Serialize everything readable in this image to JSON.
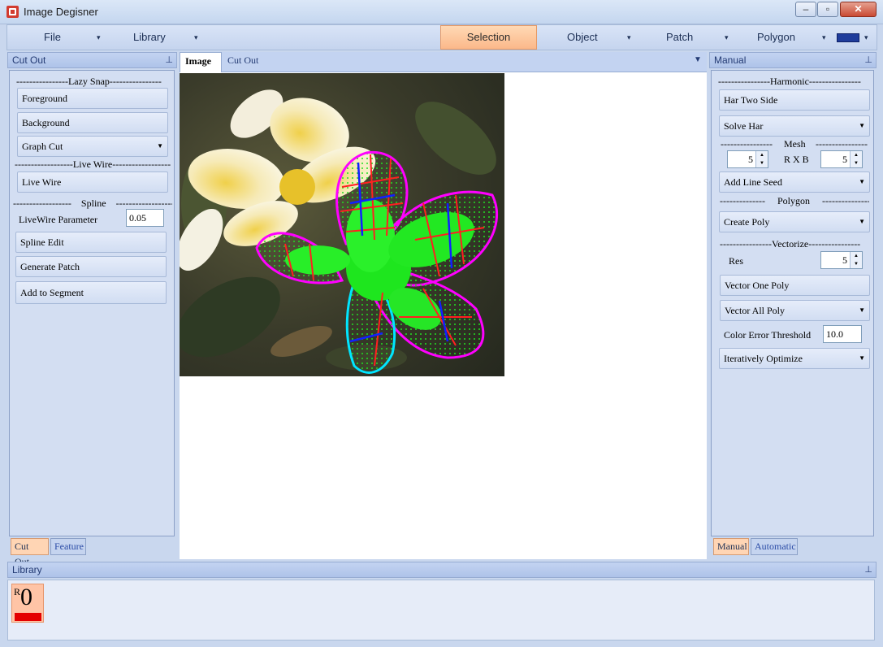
{
  "window": {
    "title": "Image Degisner",
    "minimize": "–",
    "maximize": "▫",
    "close": "✕"
  },
  "menu": {
    "file": "File",
    "library": "Library",
    "selection": "Selection",
    "object": "Object",
    "patch": "Patch",
    "polygon": "Polygon",
    "arrow": "▾",
    "polygon_color": "#1f3c9b"
  },
  "left_panel": {
    "title": "Cut Out",
    "lazy_snap_divider": "----------------Lazy Snap----------------",
    "foreground": "Foreground",
    "background": "Background",
    "graph_cut": "Graph Cut",
    "live_wire_divider": "------------------Live Wire------------------",
    "live_wire": "Live Wire",
    "spline_divider": "------------------    Spline    ------------------",
    "live_wire_param_label": "LiveWire Parameter",
    "live_wire_param_value": "0.05",
    "spline_edit": "Spline Edit",
    "generate_patch": "Generate Patch",
    "add_to_segment": "Add to Segment",
    "tabs": [
      "Cut Out",
      "Feature"
    ]
  },
  "document": {
    "tabs": [
      "Image",
      "Cut Out"
    ],
    "menu_arrow": "▼"
  },
  "right_panel": {
    "title": "Manual",
    "harmonic_divider": "----------------Harmonic----------------",
    "har_two_side": "Har Two Side",
    "solve_har": "Solve Har",
    "mesh_divider_left": "----------------",
    "mesh_label": "Mesh",
    "mesh_divider_right": "----------------",
    "mesh_r": "5",
    "rxb_label": "R X B",
    "mesh_b": "5",
    "add_line_seed": "Add Line Seed",
    "polygon_divider": "--------------     Polygon     ----------------",
    "create_poly": "Create Poly",
    "vectorize_divider": "----------------Vectorize----------------",
    "res_label": "Res",
    "res_value": "5",
    "vector_one_poly": "Vector One Poly",
    "vector_all_poly": "Vector All Poly",
    "color_error_label": "Color Error Threshold",
    "color_error_value": "10.0",
    "iteratively_optimize": "Iteratively Optimize",
    "tabs": [
      "Manual",
      "Automatic"
    ]
  },
  "library_panel": {
    "title": "Library",
    "item_letter": "R",
    "item_number": "0",
    "item_color": "#e40000"
  },
  "icons": {
    "pin": "pin-icon",
    "app": "app-icon"
  }
}
